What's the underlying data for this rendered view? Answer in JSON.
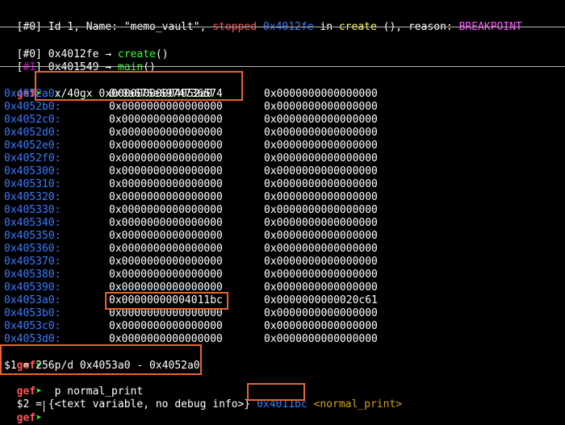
{
  "thread": {
    "index": "[#0]",
    "text_a": " Id 1, Name: \"memo_vault\", ",
    "state": "stopped",
    "space1": " ",
    "addr": "0x4012fe",
    "in": " in ",
    "func": "create",
    "rest": " (), reason: ",
    "reason": "BREAKPOINT"
  },
  "trace": [
    {
      "lb": "[",
      "idx": "#0",
      "rb": "]",
      "addr": " 0x4012fe ",
      "arrow": "→",
      "sp": " ",
      "func": "create",
      "tail": "()"
    },
    {
      "lb": "[",
      "idx": "#1",
      "rb": "]",
      "addr": " 0x401549 ",
      "arrow": "→",
      "sp": " ",
      "func": "main",
      "tail": "()"
    }
  ],
  "prompt": {
    "name": "gef",
    "glyph": "➤"
  },
  "commands": {
    "examine": "  x/40gx 0x00000000004052a0",
    "print_diff": "  p/d 0x4053a0 - 0x4052a0",
    "print_diff_result": "$1 = 256",
    "print_func": "  p normal_print",
    "print_func_result_prefix": "$2 = {<text variable, no debug info>} ",
    "print_func_addr": "0x4011bc",
    "print_func_sym": "<normal_print>"
  },
  "memory": [
    {
      "addr": "0x4052a0:",
      "v1": "0x0a676e6974736574",
      "v2": "0x0000000000000000"
    },
    {
      "addr": "0x4052b0:",
      "v1": "0x0000000000000000",
      "v2": "0x0000000000000000"
    },
    {
      "addr": "0x4052c0:",
      "v1": "0x0000000000000000",
      "v2": "0x0000000000000000"
    },
    {
      "addr": "0x4052d0:",
      "v1": "0x0000000000000000",
      "v2": "0x0000000000000000"
    },
    {
      "addr": "0x4052e0:",
      "v1": "0x0000000000000000",
      "v2": "0x0000000000000000"
    },
    {
      "addr": "0x4052f0:",
      "v1": "0x0000000000000000",
      "v2": "0x0000000000000000"
    },
    {
      "addr": "0x405300:",
      "v1": "0x0000000000000000",
      "v2": "0x0000000000000000"
    },
    {
      "addr": "0x405310:",
      "v1": "0x0000000000000000",
      "v2": "0x0000000000000000"
    },
    {
      "addr": "0x405320:",
      "v1": "0x0000000000000000",
      "v2": "0x0000000000000000"
    },
    {
      "addr": "0x405330:",
      "v1": "0x0000000000000000",
      "v2": "0x0000000000000000"
    },
    {
      "addr": "0x405340:",
      "v1": "0x0000000000000000",
      "v2": "0x0000000000000000"
    },
    {
      "addr": "0x405350:",
      "v1": "0x0000000000000000",
      "v2": "0x0000000000000000"
    },
    {
      "addr": "0x405360:",
      "v1": "0x0000000000000000",
      "v2": "0x0000000000000000"
    },
    {
      "addr": "0x405370:",
      "v1": "0x0000000000000000",
      "v2": "0x0000000000000000"
    },
    {
      "addr": "0x405380:",
      "v1": "0x0000000000000000",
      "v2": "0x0000000000000000"
    },
    {
      "addr": "0x405390:",
      "v1": "0x0000000000000000",
      "v2": "0x0000000000000000"
    },
    {
      "addr": "0x4053a0:",
      "v1": "0x00000000004011bc",
      "v2": "0x0000000000020c61"
    },
    {
      "addr": "0x4053b0:",
      "v1": "0x0000000000000000",
      "v2": "0x0000000000000000"
    },
    {
      "addr": "0x4053c0:",
      "v1": "0x0000000000000000",
      "v2": "0x0000000000000000"
    },
    {
      "addr": "0x4053d0:",
      "v1": "0x0000000000000000",
      "v2": "0x0000000000000000"
    }
  ],
  "colors": {
    "background": "#000000",
    "address": "#3a7bff",
    "prompt": "#ff5555",
    "function": "#ffff55",
    "reason": "#ff55ff",
    "highlight_box": "#e8642c"
  }
}
